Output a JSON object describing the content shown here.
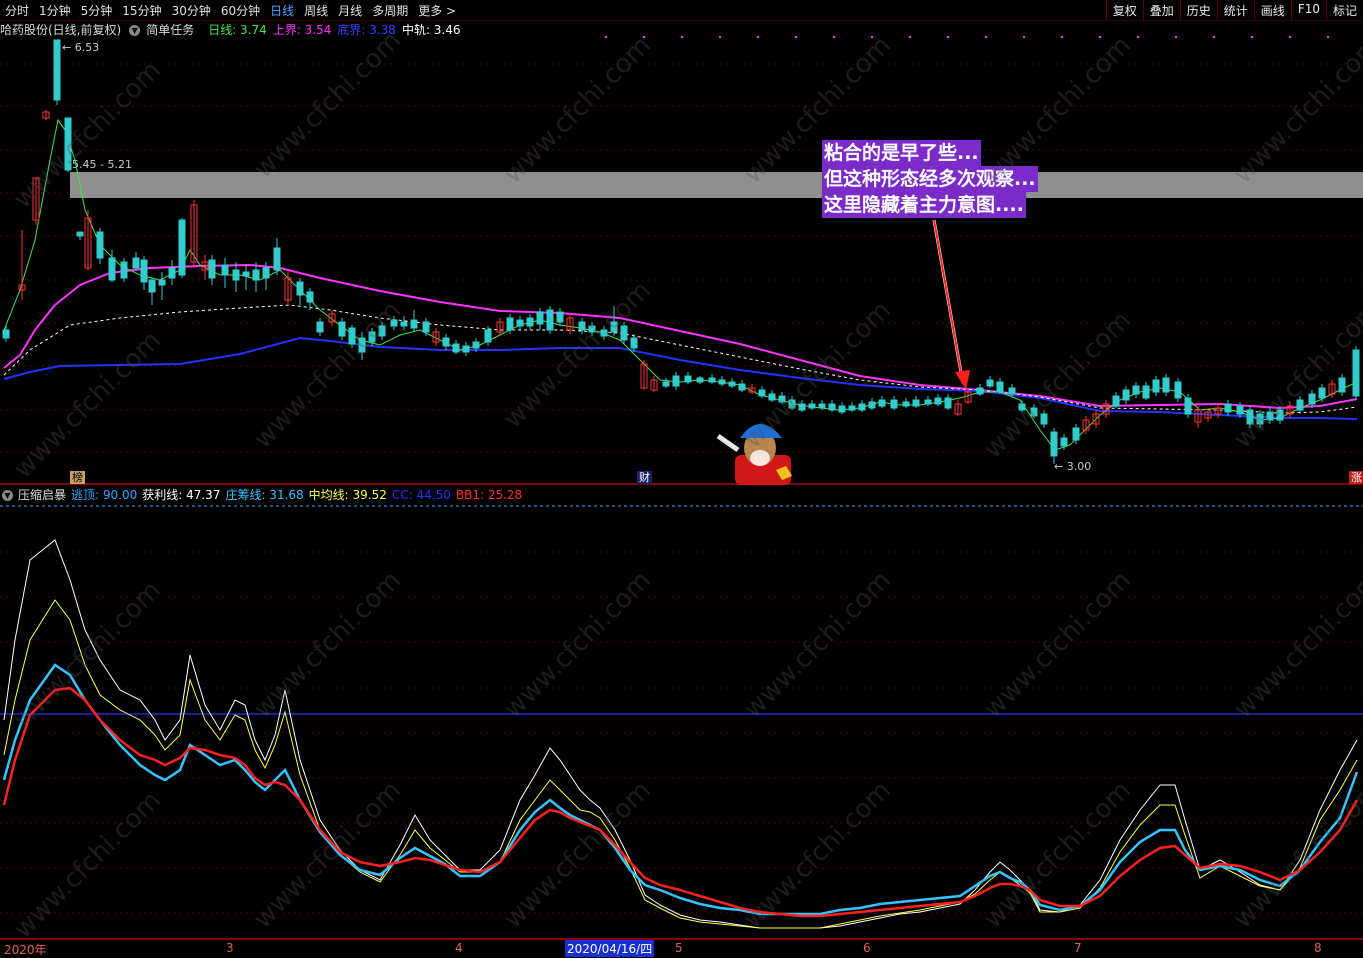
{
  "toolbar": {
    "periods": [
      "分时",
      "1分钟",
      "5分钟",
      "15分钟",
      "30分钟",
      "60分钟",
      "日线",
      "周线",
      "月线",
      "多周期",
      "更多 >"
    ],
    "active_period": "日线",
    "right_buttons": [
      "复权",
      "叠加",
      "历史",
      "统计",
      "画线",
      "F10",
      "标记"
    ]
  },
  "main_panel": {
    "stock_name": "哈药股份(日线,前复权)",
    "template": "简单任务",
    "indicators": [
      {
        "label": "日线: 3.74",
        "color": "#3ee64a"
      },
      {
        "label": "上界: 3.54",
        "color": "#ff33ff"
      },
      {
        "label": "底界: 3.38",
        "color": "#3344ff"
      },
      {
        "label": "中轨: 3.46",
        "color": "#ffffff"
      }
    ],
    "high_label": "6.53",
    "low_label": "3.00",
    "range_label": "5.45 - 5.21",
    "annotation": [
      "粘合的是早了些...",
      "但这种形态经多次观察...",
      "这里隐藏着主力意图...."
    ],
    "badges": [
      {
        "text": "榜",
        "bg": "#c8a060",
        "fg": "#000000"
      },
      {
        "text": "财",
        "bg": "#1a2266",
        "fg": "#ffffff"
      },
      {
        "text": "涨",
        "bg": "#c02020",
        "fg": "#ffffff"
      }
    ]
  },
  "lower_panel": {
    "name": "压缩启暴",
    "values": [
      {
        "label": "逃顶: 90.00",
        "color": "#2fa7ff"
      },
      {
        "label": "获利线: 47.37",
        "color": "#ffffff"
      },
      {
        "label": "庄筹线: 31.68",
        "color": "#33c4ff"
      },
      {
        "label": "中均线: 39.52",
        "color": "#ffff44"
      },
      {
        "label": "CC: 44.50",
        "color": "#2233ff"
      },
      {
        "label": "BB1: 25.28",
        "color": "#ff3030"
      }
    ]
  },
  "date_axis": {
    "labels": [
      "2020年",
      "3",
      "4",
      "2020/04/16/四",
      "5",
      "6",
      "7",
      "8"
    ],
    "selected": "2020/04/16/四"
  },
  "watermark": "www.cfchi.com",
  "colors": {
    "up": "#ff3333",
    "down": "#33cccc",
    "grid": "#5a0000",
    "upper": "#ff33ff",
    "lower": "#2233ff",
    "highlight_band": "#8f8f8f"
  }
}
